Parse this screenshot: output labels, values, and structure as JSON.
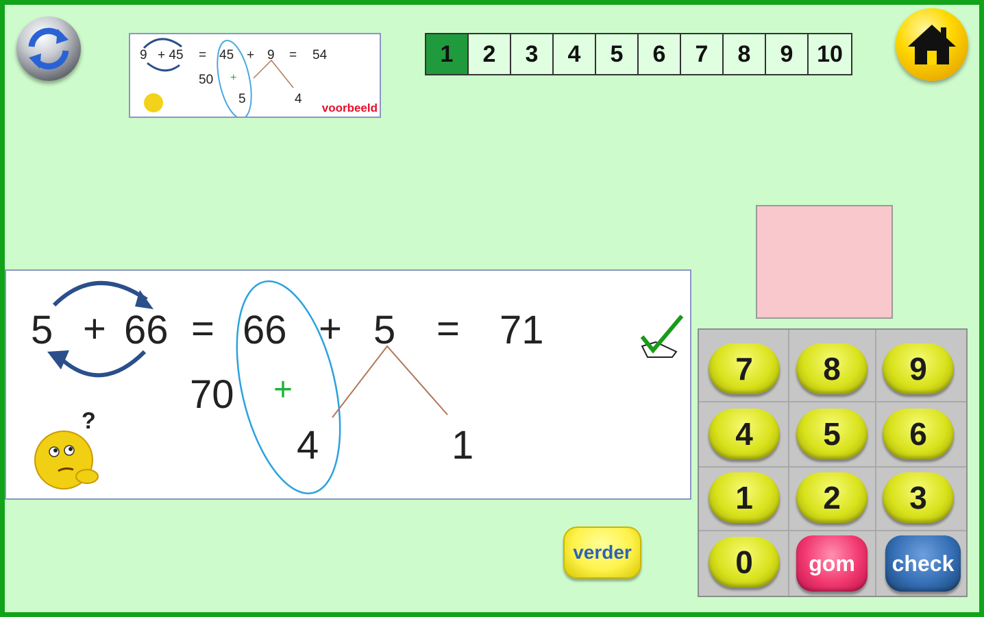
{
  "example": {
    "equation": [
      "9",
      "+ 45",
      "=",
      "45",
      "+",
      "9",
      "=",
      "54"
    ],
    "decomposition": [
      "50",
      "+",
      "5",
      "4"
    ],
    "label": "voorbeeld"
  },
  "questions": {
    "items": [
      "1",
      "2",
      "3",
      "4",
      "5",
      "6",
      "7",
      "8",
      "9",
      "10"
    ],
    "active": "1"
  },
  "exercise": {
    "a": "5",
    "plus1": "+",
    "b": "66",
    "eq1": "=",
    "b_copy": "66",
    "plus2": "+",
    "c": "5",
    "eq2": "=",
    "result": "71",
    "tens": "70",
    "plus3": "+",
    "split_left": "4",
    "split_right": "1"
  },
  "keypad": {
    "keys": [
      "7",
      "8",
      "9",
      "4",
      "5",
      "6",
      "1",
      "2",
      "3",
      "0",
      "gom",
      "check"
    ]
  },
  "verder_label": "verder",
  "icons": [
    "refresh-icon",
    "home-icon",
    "checkmark-icon",
    "thinking-smiley-icon"
  ],
  "colors": {
    "background": "#cdfbcb",
    "border": "#12a31b",
    "answer_box": "#f9c8cc",
    "active_question": "#1f9a3c"
  }
}
